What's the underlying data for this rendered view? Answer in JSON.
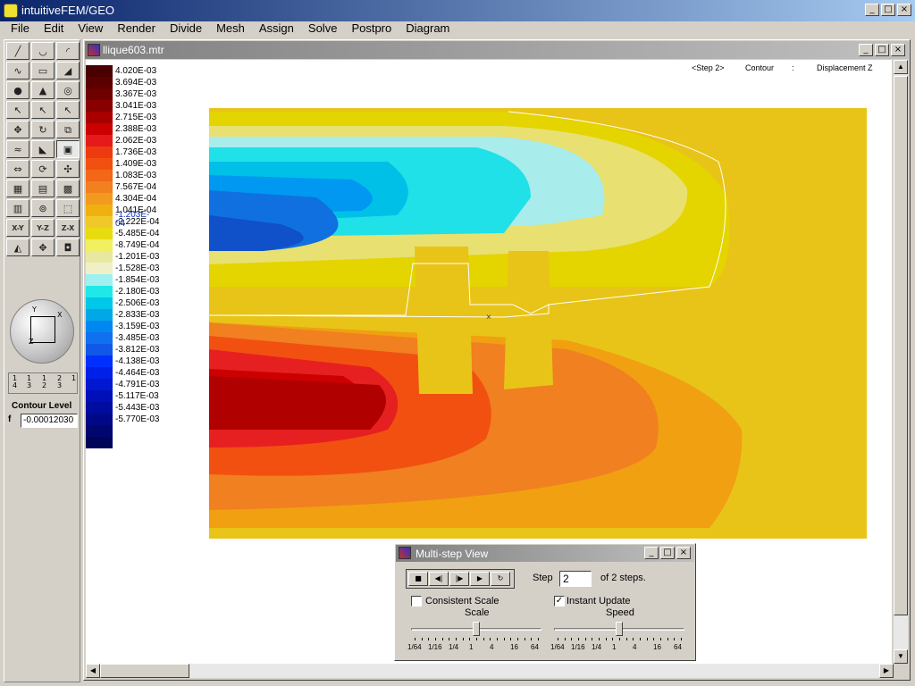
{
  "app": {
    "title": "intuitiveFEM/GEO"
  },
  "menu": [
    "File",
    "Edit",
    "View",
    "Render",
    "Divide",
    "Mesh",
    "Assign",
    "Solve",
    "Postpro",
    "Diagram"
  ],
  "toolbox": {
    "tools": [
      {
        "name": "line-tool-icon",
        "glyph": "╱"
      },
      {
        "name": "arc-tool-icon",
        "glyph": "◡"
      },
      {
        "name": "curve-tool-icon",
        "glyph": "◜"
      },
      {
        "name": "spline-tool-icon",
        "glyph": "∿"
      },
      {
        "name": "rectangle-tool-icon",
        "glyph": "▭"
      },
      {
        "name": "surface-tool-icon",
        "glyph": "◢"
      },
      {
        "name": "sphere-tool-icon",
        "glyph": "●"
      },
      {
        "name": "cone-tool-icon",
        "glyph": "▲"
      },
      {
        "name": "torus-tool-icon",
        "glyph": "◎"
      },
      {
        "name": "select-tool-icon",
        "glyph": "↖"
      },
      {
        "name": "select-edge-icon",
        "glyph": "↖"
      },
      {
        "name": "select-face-icon",
        "glyph": "↖"
      },
      {
        "name": "move-node-icon",
        "glyph": "✥"
      },
      {
        "name": "rotate-node-icon",
        "glyph": "↻"
      },
      {
        "name": "scale-node-icon",
        "glyph": "⧉"
      },
      {
        "name": "wave-tool-icon",
        "glyph": "≈"
      },
      {
        "name": "sweep-tool-icon",
        "glyph": "◣"
      },
      {
        "name": "contour-select-icon",
        "glyph": "▣"
      },
      {
        "name": "translate-view-icon",
        "glyph": "⇔"
      },
      {
        "name": "rotate-view-icon",
        "glyph": "⟳"
      },
      {
        "name": "pan-view-icon",
        "glyph": "✣"
      },
      {
        "name": "box-view-icon",
        "glyph": "▦"
      },
      {
        "name": "wire-box-icon",
        "glyph": "▤"
      },
      {
        "name": "solid-box-icon",
        "glyph": "▩"
      },
      {
        "name": "mesh-box-icon",
        "glyph": "▥"
      },
      {
        "name": "orbit-view-icon",
        "glyph": "⊚"
      },
      {
        "name": "perspective-view-icon",
        "glyph": "⬚"
      },
      {
        "name": "view-xy-icon",
        "text": "X-Y"
      },
      {
        "name": "view-yz-icon",
        "text": "Y-Z"
      },
      {
        "name": "view-zx-icon",
        "text": "Z-X"
      },
      {
        "name": "fit-view-icon",
        "glyph": "◭"
      },
      {
        "name": "zoom-all-icon",
        "glyph": "✥"
      },
      {
        "name": "center-view-icon",
        "glyph": "◘"
      }
    ],
    "globe_axes": {
      "y": "Y",
      "x": "X",
      "z": "Z"
    },
    "steps_top": [
      "1",
      "1",
      "1",
      "2",
      "1"
    ],
    "steps_bottom": [
      "4",
      "3",
      "2",
      "3",
      ""
    ],
    "contour_level_label": "Contour Level",
    "f_label": "f",
    "f_value": "-0.00012030"
  },
  "document": {
    "title": "llique603.mtr",
    "header_step": "<Step 2>",
    "header_mode": "Contour",
    "header_sep": ":",
    "header_quantity": "Displacement Z"
  },
  "legend": {
    "colors": [
      "#4a0000",
      "#5a0000",
      "#6e0000",
      "#8a0000",
      "#a80000",
      "#cc0000",
      "#e61a1a",
      "#ee3a10",
      "#f25010",
      "#f26818",
      "#f28020",
      "#f29a20",
      "#f0b010",
      "#f0c828",
      "#e8dc10",
      "#f0f060",
      "#e8e8a0",
      "#f0f0c8",
      "#a0f0f0",
      "#20e8e8",
      "#00c8e8",
      "#00a8e8",
      "#0088f0",
      "#1070f0",
      "#1058e8",
      "#0030ff",
      "#0020e8",
      "#0018d0",
      "#0010b8",
      "#000ca0",
      "#000888",
      "#000670",
      "#000458"
    ],
    "labels": [
      "4.020E-03",
      "3.694E-03",
      "3.367E-03",
      "3.041E-03",
      "2.715E-03",
      "2.388E-03",
      "2.062E-03",
      "1.736E-03",
      "1.409E-03",
      "1.083E-03",
      "7.567E-04",
      "4.304E-04",
      "1.041E-04",
      "-2.222E-04",
      "-5.485E-04",
      "-8.749E-04",
      "-1.201E-03",
      "-1.528E-03",
      "-1.854E-03",
      "-2.180E-03",
      "-2.506E-03",
      "-2.833E-03",
      "-3.159E-03",
      "-3.485E-03",
      "-3.812E-03",
      "-4.138E-03",
      "-4.464E-03",
      "-4.791E-03",
      "-5.117E-03",
      "-5.443E-03",
      "-5.770E-03"
    ],
    "marker": "-1.203E-04"
  },
  "multistep": {
    "title": "Multi-step View",
    "buttons": [
      {
        "name": "stop-icon",
        "glyph": "■"
      },
      {
        "name": "step-back-icon",
        "glyph": "◀|"
      },
      {
        "name": "play-pause-icon",
        "glyph": "|▶"
      },
      {
        "name": "play-icon",
        "glyph": "▶"
      },
      {
        "name": "loop-icon",
        "glyph": "↻"
      }
    ],
    "step_label": "Step",
    "step_value": "2",
    "of_steps_label": "of 2 steps.",
    "consistent_scale_label": "Consistent Scale",
    "consistent_scale_checked": false,
    "instant_update_label": "Instant Update",
    "instant_update_checked": true,
    "checkmark": "✓",
    "scale_label": "Scale",
    "speed_label": "Speed",
    "slider_ticks": [
      "1/64",
      "1/16",
      "1/4",
      "1",
      "4",
      "16",
      "64"
    ],
    "scale_value": "1",
    "speed_value": "1"
  },
  "icons": {
    "minimize": "_",
    "restore": "□",
    "close": "×",
    "up": "▲",
    "down": "▼",
    "left": "◀",
    "right": "▶"
  }
}
